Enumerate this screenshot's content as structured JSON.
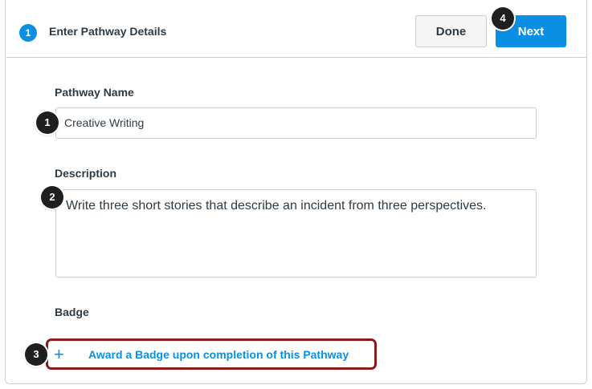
{
  "header": {
    "step_number": "1",
    "title": "Enter Pathway Details",
    "done_label": "Done",
    "next_label": "Next"
  },
  "form": {
    "name_label": "Pathway Name",
    "name_value": "Creative Writing",
    "description_label": "Description",
    "description_value": "Write three short stories that describe an incident from three perspectives.",
    "badge_label": "Badge",
    "badge_link_icon": "+",
    "badge_link_text": "Award a Badge upon completion of this Pathway"
  },
  "markers": {
    "m1": "1",
    "m2": "2",
    "m3": "3",
    "m4": "4"
  },
  "colors": {
    "accent": "#0b8fe3",
    "highlight_border": "#8b1a1a",
    "marker": "#1f1f1f"
  }
}
